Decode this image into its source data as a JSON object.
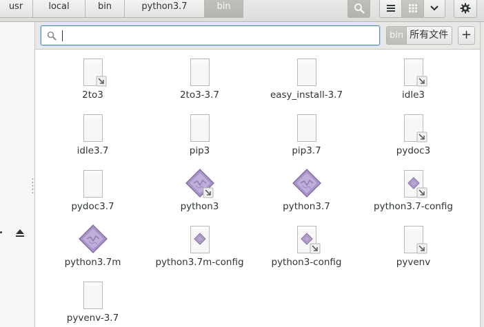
{
  "breadcrumbs": [
    {
      "label": "usr",
      "active": false
    },
    {
      "label": "local",
      "active": false
    },
    {
      "label": "bin",
      "active": false
    },
    {
      "label": "python3.7",
      "active": false
    },
    {
      "label": "bin",
      "active": true
    }
  ],
  "toolbar": {
    "search_icon": "search-icon",
    "list_view_icon": "list-view-icon",
    "grid_view_icon": "grid-view-icon",
    "menu_icon": "chevron-down-icon",
    "settings_icon": "gear-icon"
  },
  "search": {
    "value": "",
    "placeholder": ""
  },
  "location": {
    "chip": "bin",
    "filter": "所有文件",
    "add_label": "+"
  },
  "sidebar": {
    "eject_icon": "eject-icon"
  },
  "files": [
    {
      "name": "2to3",
      "kind": "link"
    },
    {
      "name": "2to3-3.7",
      "kind": "plain"
    },
    {
      "name": "easy_install-3.7",
      "kind": "plain"
    },
    {
      "name": "idle3",
      "kind": "link"
    },
    {
      "name": "idle3.7",
      "kind": "plain"
    },
    {
      "name": "pip3",
      "kind": "plain"
    },
    {
      "name": "pip3.7",
      "kind": "plain"
    },
    {
      "name": "pydoc3",
      "kind": "link"
    },
    {
      "name": "pydoc3.7",
      "kind": "plain"
    },
    {
      "name": "python3",
      "kind": "exec-link"
    },
    {
      "name": "python3.7",
      "kind": "exec"
    },
    {
      "name": "python3.7-config",
      "kind": "script-link"
    },
    {
      "name": "python3.7m",
      "kind": "exec"
    },
    {
      "name": "python3.7m-config",
      "kind": "script"
    },
    {
      "name": "python3-config",
      "kind": "script-link"
    },
    {
      "name": "pyvenv",
      "kind": "link"
    },
    {
      "name": "pyvenv-3.7",
      "kind": "plain"
    }
  ],
  "colors": {
    "accent": "#4a90d9",
    "exec_purple": "#a48cc4",
    "active_tab": "#bcbcb9"
  }
}
